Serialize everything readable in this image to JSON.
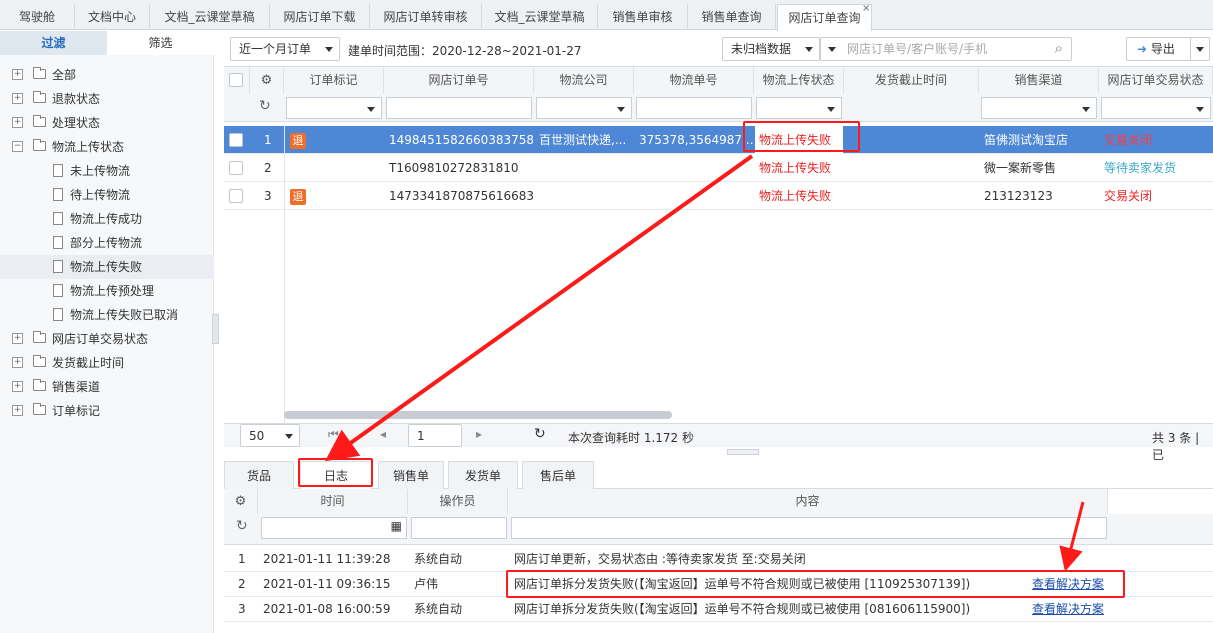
{
  "tabs": [
    "驾驶舱",
    "文档中心",
    "文档_云课堂草稿",
    "网店订单下载",
    "网店订单转审核",
    "文档_云课堂草稿",
    "销售单审核",
    "销售单查询",
    "网店订单查询"
  ],
  "tab_close": "×",
  "sidebar": {
    "tab_filter": "过滤",
    "tab_select": "筛选",
    "tree": [
      "全部",
      "退款状态",
      "处理状态",
      "物流上传状态",
      "未上传物流",
      "待上传物流",
      "物流上传成功",
      "部分上传物流",
      "物流上传失败",
      "物流上传预处理",
      "物流上传失败已取消",
      "网店订单交易状态",
      "发货截止时间",
      "销售渠道",
      "订单标记"
    ]
  },
  "toolbar": {
    "range_select": "近一个月订单",
    "time_range": "建单时间范围：2020-12-28~2021-01-27",
    "archive_select": "未归档数据",
    "search_placeholder": "网店订单号/客户账号/手机",
    "export": "导出"
  },
  "grid": {
    "headers": [
      "订单标记",
      "网店订单号",
      "物流公司",
      "物流单号",
      "物流上传状态",
      "发货截止时间",
      "销售渠道",
      "网店订单交易状态"
    ],
    "rows": [
      {
        "num": "1",
        "badge": "退",
        "order": "1498451582660383758",
        "logistics": "百世测试快递,...",
        "tracking": "375378,3564987...",
        "upload": "物流上传失败",
        "channel": "笛佛测试淘宝店",
        "status": "交易关闭"
      },
      {
        "num": "2",
        "badge": "",
        "order": "T1609810272831810",
        "logistics": "",
        "tracking": "",
        "upload": "物流上传失败",
        "channel": "微一案新零售",
        "status": "等待卖家发货"
      },
      {
        "num": "3",
        "badge": "退",
        "order": "1473341870875616683",
        "logistics": "",
        "tracking": "",
        "upload": "物流上传失败",
        "channel": "213123123",
        "status": "交易关闭"
      }
    ]
  },
  "pager": {
    "size": "50",
    "page": "1",
    "timing": "本次查询耗时 1.172 秒",
    "total": "共 3 条 | 已"
  },
  "bottom_tabs": [
    "货品",
    "日志",
    "销售单",
    "发货单",
    "售后单"
  ],
  "log": {
    "headers": [
      "时间",
      "操作员",
      "内容"
    ],
    "rows": [
      {
        "num": "1",
        "time": "2021-01-11 11:39:28",
        "op": "系统自动",
        "content": "网店订单更新，交易状态由 :等待卖家发货 至:交易关闭",
        "link": ""
      },
      {
        "num": "2",
        "time": "2021-01-11 09:36:15",
        "op": "卢伟",
        "content": "网店订单拆分发货失败(【淘宝返回】运单号不符合规则或已被使用 [110925307139])",
        "link": "查看解决方案"
      },
      {
        "num": "3",
        "time": "2021-01-08 16:00:59",
        "op": "系统自动",
        "content": "网店订单拆分发货失败(【淘宝返回】运单号不符合规则或已被使用 [081606115900])",
        "link": "查看解决方案"
      }
    ]
  },
  "colors": {
    "accent": "#4d87d6",
    "annotation": "#ff1a1a",
    "badge": "#f06d2a"
  }
}
